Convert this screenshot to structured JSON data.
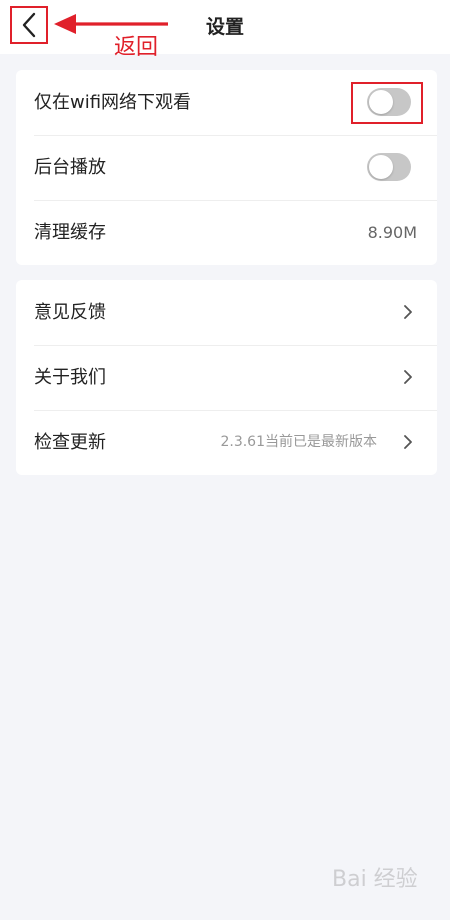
{
  "header": {
    "title": "设置",
    "back_annotation": "返回"
  },
  "settings_card": {
    "items": [
      {
        "label": "仅在wifi网络下观看",
        "type": "toggle",
        "on": false
      },
      {
        "label": "后台播放",
        "type": "toggle",
        "on": false
      },
      {
        "label": "清理缓存",
        "type": "value",
        "value": "8.90M"
      }
    ]
  },
  "info_card": {
    "items": [
      {
        "label": "意见反馈",
        "type": "link"
      },
      {
        "label": "关于我们",
        "type": "link"
      },
      {
        "label": "检查更新",
        "type": "link",
        "note": "2.3.61当前已是最新版本"
      }
    ]
  },
  "watermark": {
    "text": "Bai 经验"
  },
  "colors": {
    "background": "#f4f5f9",
    "card": "#ffffff",
    "annotation": "#e0202a",
    "toggle_off": "#c7c7c7",
    "text_primary": "#222222",
    "text_secondary": "#999999"
  },
  "icons": [
    "back-chevron-icon",
    "annotation-arrow-icon",
    "chevron-right-icon"
  ]
}
